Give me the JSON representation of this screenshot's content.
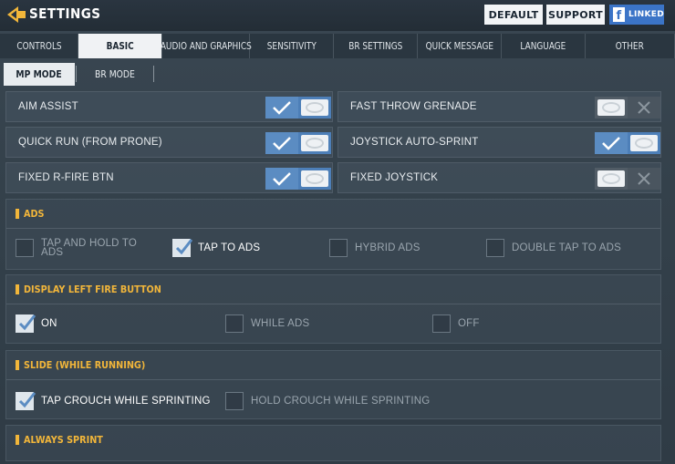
{
  "header": {
    "title": "SETTINGS",
    "default_label": "DEFAULT",
    "support_label": "SUPPORT",
    "linked_label": "LINKED",
    "accent": "#f2b63a"
  },
  "tabs": [
    {
      "label": "CONTROLS",
      "active": false
    },
    {
      "label": "BASIC",
      "active": true
    },
    {
      "label": "AUDIO AND GRAPHICS",
      "active": false
    },
    {
      "label": "SENSITIVITY",
      "active": false
    },
    {
      "label": "BR SETTINGS",
      "active": false
    },
    {
      "label": "QUICK MESSAGE",
      "active": false
    },
    {
      "label": "LANGUAGE",
      "active": false
    },
    {
      "label": "OTHER",
      "active": false
    }
  ],
  "modes": {
    "mp": "MP MODE",
    "br": "BR MODE"
  },
  "toggles": {
    "aim_assist": {
      "label": "AIM ASSIST",
      "on": true
    },
    "quick_run": {
      "label": "QUICK RUN (FROM PRONE)",
      "on": true
    },
    "fixed_rfire": {
      "label": "FIXED R-FIRE BTN",
      "on": true
    },
    "fast_throw": {
      "label": "FAST THROW GRENADE",
      "on": false
    },
    "joystick_sprint": {
      "label": "JOYSTICK AUTO-SPRINT",
      "on": true
    },
    "fixed_joystick": {
      "label": "FIXED JOYSTICK",
      "on": false
    }
  },
  "sections": {
    "ads": {
      "title": "ADS",
      "options": [
        {
          "label1": "TAP AND HOLD TO",
          "label2": "ADS",
          "checked": false
        },
        {
          "label1": "TAP TO ADS",
          "label2": "",
          "checked": true
        },
        {
          "label1": "HYBRID ADS",
          "label2": "",
          "checked": false
        },
        {
          "label1": "DOUBLE TAP TO ADS",
          "label2": "",
          "checked": false
        }
      ]
    },
    "display_left": {
      "title": "DISPLAY LEFT FIRE BUTTON",
      "options": [
        {
          "label1": "ON",
          "checked": true
        },
        {
          "label1": "WHILE ADS",
          "checked": false
        },
        {
          "label1": "OFF",
          "checked": false
        }
      ]
    },
    "slide": {
      "title": "SLIDE (WHILE RUNNING)",
      "options": [
        {
          "label1": "TAP CROUCH WHILE SPRINTING",
          "checked": true
        },
        {
          "label1": "HOLD CROUCH WHILE SPRINTING",
          "checked": false
        }
      ]
    },
    "always_sprint": {
      "title": "ALWAYS SPRINT"
    }
  }
}
